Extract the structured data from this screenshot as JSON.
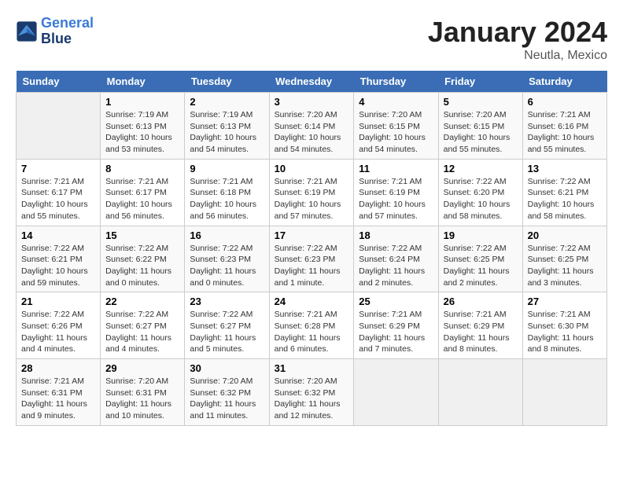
{
  "header": {
    "logo_line1": "General",
    "logo_line2": "Blue",
    "month": "January 2024",
    "location": "Neutla, Mexico"
  },
  "weekdays": [
    "Sunday",
    "Monday",
    "Tuesday",
    "Wednesday",
    "Thursday",
    "Friday",
    "Saturday"
  ],
  "weeks": [
    [
      {
        "day": "",
        "info": ""
      },
      {
        "day": "1",
        "info": "Sunrise: 7:19 AM\nSunset: 6:13 PM\nDaylight: 10 hours\nand 53 minutes."
      },
      {
        "day": "2",
        "info": "Sunrise: 7:19 AM\nSunset: 6:13 PM\nDaylight: 10 hours\nand 54 minutes."
      },
      {
        "day": "3",
        "info": "Sunrise: 7:20 AM\nSunset: 6:14 PM\nDaylight: 10 hours\nand 54 minutes."
      },
      {
        "day": "4",
        "info": "Sunrise: 7:20 AM\nSunset: 6:15 PM\nDaylight: 10 hours\nand 54 minutes."
      },
      {
        "day": "5",
        "info": "Sunrise: 7:20 AM\nSunset: 6:15 PM\nDaylight: 10 hours\nand 55 minutes."
      },
      {
        "day": "6",
        "info": "Sunrise: 7:21 AM\nSunset: 6:16 PM\nDaylight: 10 hours\nand 55 minutes."
      }
    ],
    [
      {
        "day": "7",
        "info": "Sunrise: 7:21 AM\nSunset: 6:17 PM\nDaylight: 10 hours\nand 55 minutes."
      },
      {
        "day": "8",
        "info": "Sunrise: 7:21 AM\nSunset: 6:17 PM\nDaylight: 10 hours\nand 56 minutes."
      },
      {
        "day": "9",
        "info": "Sunrise: 7:21 AM\nSunset: 6:18 PM\nDaylight: 10 hours\nand 56 minutes."
      },
      {
        "day": "10",
        "info": "Sunrise: 7:21 AM\nSunset: 6:19 PM\nDaylight: 10 hours\nand 57 minutes."
      },
      {
        "day": "11",
        "info": "Sunrise: 7:21 AM\nSunset: 6:19 PM\nDaylight: 10 hours\nand 57 minutes."
      },
      {
        "day": "12",
        "info": "Sunrise: 7:22 AM\nSunset: 6:20 PM\nDaylight: 10 hours\nand 58 minutes."
      },
      {
        "day": "13",
        "info": "Sunrise: 7:22 AM\nSunset: 6:21 PM\nDaylight: 10 hours\nand 58 minutes."
      }
    ],
    [
      {
        "day": "14",
        "info": "Sunrise: 7:22 AM\nSunset: 6:21 PM\nDaylight: 10 hours\nand 59 minutes."
      },
      {
        "day": "15",
        "info": "Sunrise: 7:22 AM\nSunset: 6:22 PM\nDaylight: 11 hours\nand 0 minutes."
      },
      {
        "day": "16",
        "info": "Sunrise: 7:22 AM\nSunset: 6:23 PM\nDaylight: 11 hours\nand 0 minutes."
      },
      {
        "day": "17",
        "info": "Sunrise: 7:22 AM\nSunset: 6:23 PM\nDaylight: 11 hours\nand 1 minute."
      },
      {
        "day": "18",
        "info": "Sunrise: 7:22 AM\nSunset: 6:24 PM\nDaylight: 11 hours\nand 2 minutes."
      },
      {
        "day": "19",
        "info": "Sunrise: 7:22 AM\nSunset: 6:25 PM\nDaylight: 11 hours\nand 2 minutes."
      },
      {
        "day": "20",
        "info": "Sunrise: 7:22 AM\nSunset: 6:25 PM\nDaylight: 11 hours\nand 3 minutes."
      }
    ],
    [
      {
        "day": "21",
        "info": "Sunrise: 7:22 AM\nSunset: 6:26 PM\nDaylight: 11 hours\nand 4 minutes."
      },
      {
        "day": "22",
        "info": "Sunrise: 7:22 AM\nSunset: 6:27 PM\nDaylight: 11 hours\nand 4 minutes."
      },
      {
        "day": "23",
        "info": "Sunrise: 7:22 AM\nSunset: 6:27 PM\nDaylight: 11 hours\nand 5 minutes."
      },
      {
        "day": "24",
        "info": "Sunrise: 7:21 AM\nSunset: 6:28 PM\nDaylight: 11 hours\nand 6 minutes."
      },
      {
        "day": "25",
        "info": "Sunrise: 7:21 AM\nSunset: 6:29 PM\nDaylight: 11 hours\nand 7 minutes."
      },
      {
        "day": "26",
        "info": "Sunrise: 7:21 AM\nSunset: 6:29 PM\nDaylight: 11 hours\nand 8 minutes."
      },
      {
        "day": "27",
        "info": "Sunrise: 7:21 AM\nSunset: 6:30 PM\nDaylight: 11 hours\nand 8 minutes."
      }
    ],
    [
      {
        "day": "28",
        "info": "Sunrise: 7:21 AM\nSunset: 6:31 PM\nDaylight: 11 hours\nand 9 minutes."
      },
      {
        "day": "29",
        "info": "Sunrise: 7:20 AM\nSunset: 6:31 PM\nDaylight: 11 hours\nand 10 minutes."
      },
      {
        "day": "30",
        "info": "Sunrise: 7:20 AM\nSunset: 6:32 PM\nDaylight: 11 hours\nand 11 minutes."
      },
      {
        "day": "31",
        "info": "Sunrise: 7:20 AM\nSunset: 6:32 PM\nDaylight: 11 hours\nand 12 minutes."
      },
      {
        "day": "",
        "info": ""
      },
      {
        "day": "",
        "info": ""
      },
      {
        "day": "",
        "info": ""
      }
    ]
  ]
}
